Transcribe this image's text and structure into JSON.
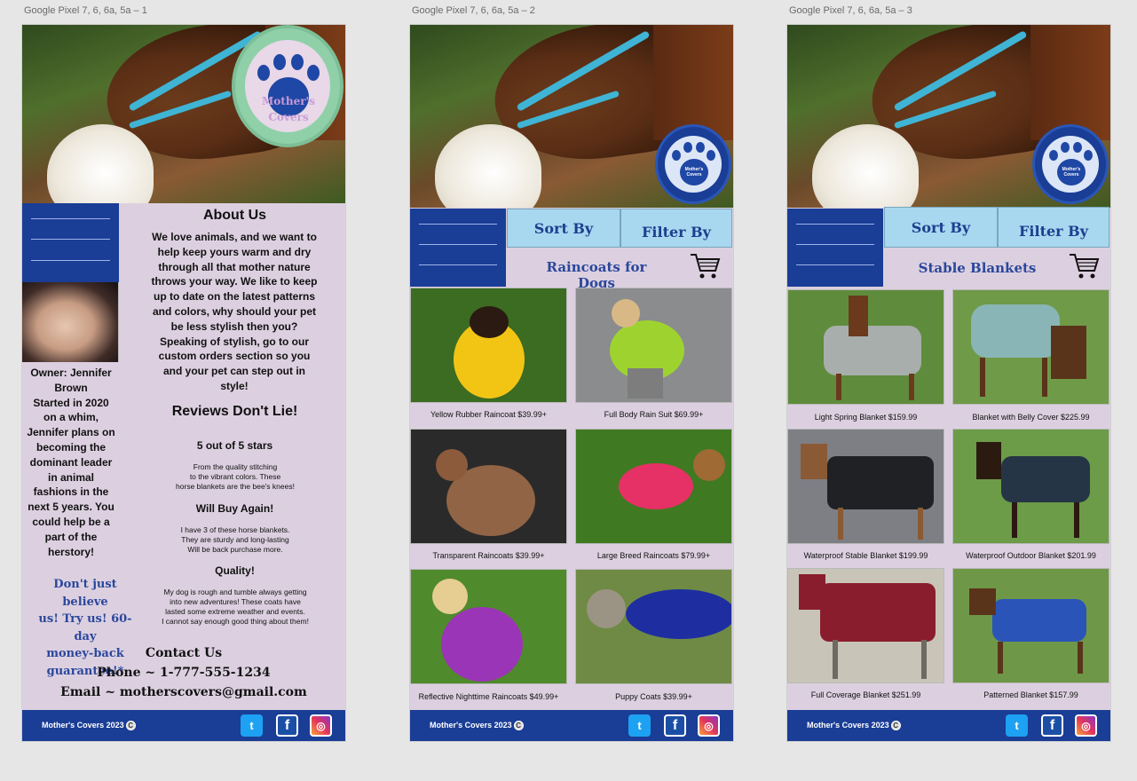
{
  "frames": [
    "Google Pixel 7, 6, 6a, 5a – 1",
    "Google Pixel 7, 6, 6a, 5a – 2",
    "Google Pixel 7, 6, 6a, 5a – 3"
  ],
  "brand": {
    "logo_line1": "Mother's",
    "logo_line2": "Covers",
    "small_logo": "Mother's Covers"
  },
  "colors": {
    "navy": "#1a3d96",
    "lavender": "#dcd0e0",
    "sky": "#a7d8f0",
    "accent_text": "#2b479c"
  },
  "screen1": {
    "about_title": "About Us",
    "about_lines": [
      "We love animals, and we want to",
      "help keep yours warm and dry",
      "through all that mother nature",
      "throws your way. We like to keep",
      "up to date on the latest patterns",
      "and colors, why should your pet",
      "be less stylish then you?",
      "Speaking of stylish, go to our",
      "custom orders section so you",
      "and your pet can step out in",
      "style!"
    ],
    "owner_lines": [
      "Owner: Jennifer",
      "Brown",
      "Started in 2020",
      "on a whim,",
      "Jennifer plans on",
      "becoming the",
      "dominant leader",
      "in animal",
      "fashions in the",
      "next 5 years. You",
      "could help be a",
      "part of the",
      "herstory!"
    ],
    "reviews_title": "Reviews Don't Lie!",
    "review1_title": "5 out of 5 stars",
    "review1_lines": [
      "From the quality stitching",
      "to the vibrant colors. These",
      "horse blankets are the bee's knees!"
    ],
    "review2_title": "Will Buy Again!",
    "review2_lines": [
      "I have 3 of these horse blankets.",
      "They are sturdy and long-lasting",
      "Will be back purchase more."
    ],
    "review3_title": "Quality!",
    "review3_lines": [
      "My dog is rough and tumble always getting",
      "into new adventures! These coats have",
      "lasted some extreme weather and events.",
      "I cannot say enough good thing about them!"
    ],
    "guarantee_lines": [
      "Don't just believe",
      "us! Try us! 60-day",
      "money-back",
      "guarantee!*"
    ],
    "contact_title": "Contact Us",
    "phone": "Phone ~ 1-777-555-1234",
    "email": "Email ~ motherscovers@gmail.com"
  },
  "screen2": {
    "sort_label": "Sort By",
    "filter_label": "Filter By",
    "section_title": "Raincoats for Dogs",
    "products": [
      {
        "label": "Yellow Rubber Raincoat $39.99+",
        "bg": "#3c6b22",
        "coat": "#f2c515"
      },
      {
        "label": "Full Body Rain Suit $69.99+",
        "bg": "#8a8c8e",
        "coat": "#9ed32f"
      },
      {
        "label": "Transparent Raincoats $39.99+",
        "bg": "#2a2a2a",
        "coat": "#9b6a48"
      },
      {
        "label": "Large Breed Raincoats $79.99+",
        "bg": "#3f7a22",
        "coat": "#e53165"
      },
      {
        "label": "Reflective Nighttime Raincoats $49.99+",
        "bg": "#4f8a2c",
        "coat": "#9b35b7"
      },
      {
        "label": "Puppy Coats $39.99+",
        "bg": "#6f8a45",
        "coat": "#1e2ea1"
      }
    ]
  },
  "screen3": {
    "sort_label": "Sort By",
    "filter_label": "Filter By",
    "section_title": "Stable Blankets",
    "products": [
      {
        "label": "Light Spring Blanket $159.99",
        "bg": "#5f8c3c",
        "coat": "#a8aeab"
      },
      {
        "label": "Blanket with Belly Cover $225.99",
        "bg": "#6f9a48",
        "coat": "#8ab5b6"
      },
      {
        "label": "Waterproof Stable Blanket $199.99",
        "bg": "#7d7f84",
        "coat": "#1f2124"
      },
      {
        "label": "Waterproof Outdoor Blanket $201.99",
        "bg": "#6c9c48",
        "coat": "#263545"
      },
      {
        "label": "Full Coverage Blanket $251.99",
        "bg": "#c9c4b8",
        "coat": "#8a1d2d"
      },
      {
        "label": "Patterned Blanket $157.99",
        "bg": "#6f9748",
        "coat": "#2a54b8"
      }
    ]
  },
  "footer": {
    "brand": "Mother's Covers 2023",
    "copyright_symbol": "C",
    "twitter_icon": "twitter-icon",
    "facebook_icon": "facebook-icon",
    "instagram_icon": "instagram-icon"
  }
}
